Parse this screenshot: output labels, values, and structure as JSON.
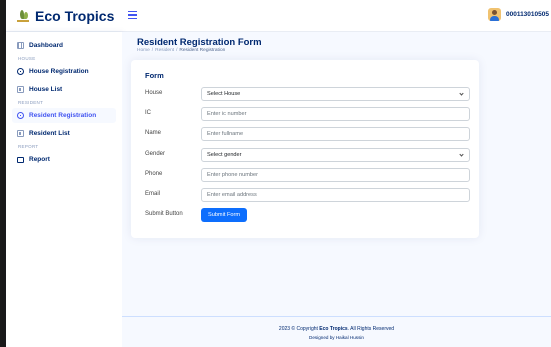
{
  "app": {
    "name": "Eco Tropics"
  },
  "header": {
    "user_name": "000113010505"
  },
  "sidebar": {
    "items": [
      {
        "label": "Dashboard",
        "icon": "grid-icon"
      },
      {
        "heading": "HOUSE"
      },
      {
        "label": "House Registration",
        "icon": "circle-icon"
      },
      {
        "label": "House List",
        "icon": "list-icon"
      },
      {
        "heading": "RESIDENT"
      },
      {
        "label": "Resident Registration",
        "icon": "circle-icon",
        "active": true
      },
      {
        "label": "Resident List",
        "icon": "list-icon"
      },
      {
        "heading": "REPORT"
      },
      {
        "label": "Report",
        "icon": "report-icon"
      }
    ]
  },
  "page": {
    "title": "Resident Registration Form",
    "breadcrumb": [
      "Home",
      "Resident",
      "Resident Registration"
    ]
  },
  "form": {
    "title": "Form",
    "house": {
      "label": "House",
      "value": "Select House"
    },
    "ic": {
      "label": "IC",
      "placeholder": "Enter ic number"
    },
    "name": {
      "label": "Name",
      "placeholder": "Enter fullname"
    },
    "gender": {
      "label": "Gender",
      "value": "Select gender"
    },
    "phone": {
      "label": "Phone",
      "placeholder": "Enter phone number"
    },
    "email": {
      "label": "Email",
      "placeholder": "Enter email address"
    },
    "submit": {
      "label": "Submit Button",
      "button": "Submit Form"
    }
  },
  "footer": {
    "copyright_prefix": "2023 © Copyright",
    "brand": "Eco Tropics",
    "copyright_suffix": ". All Rights Reserved",
    "credits": "Designed by Haikal Hussin"
  },
  "colors": {
    "primary": "#4154f1",
    "navy": "#012970",
    "button": "#0d6efd",
    "background": "#f6f9ff"
  }
}
